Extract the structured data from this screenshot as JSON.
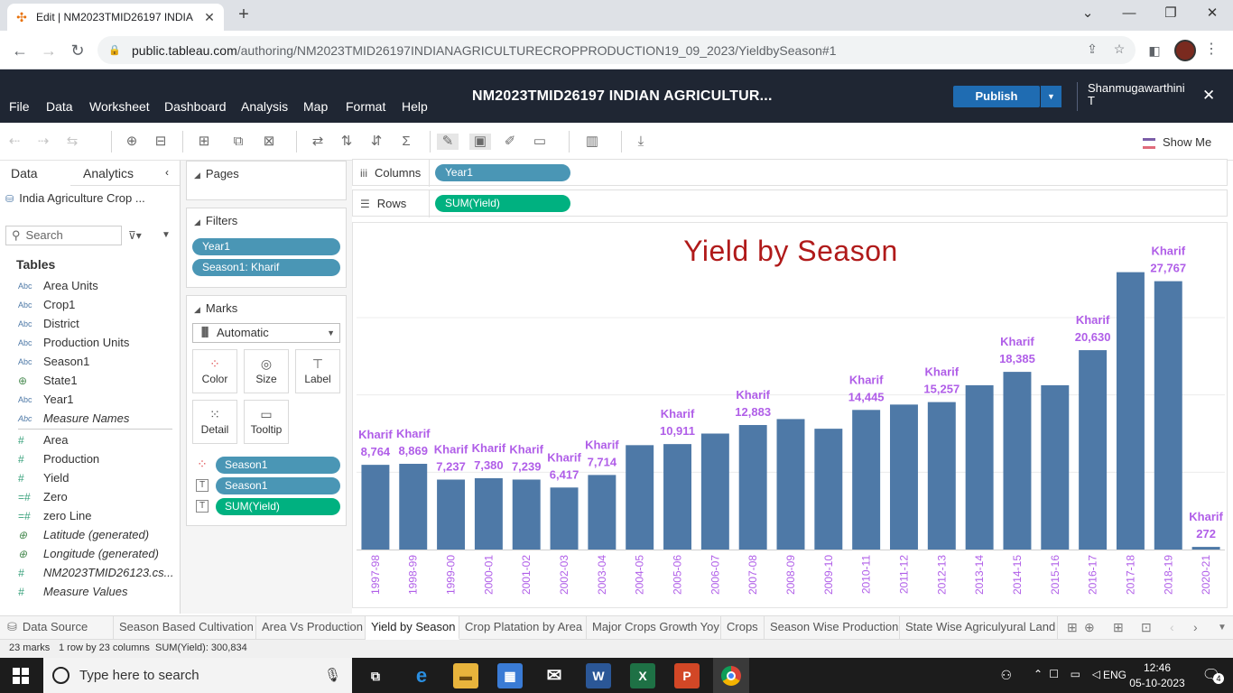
{
  "browser": {
    "tab_title": "Edit | NM2023TMID26197 INDIA",
    "url_host": "public.tableau.com",
    "url_path": "/authoring/NM2023TMID26197INDIANAGRICULTURECROPPRODUCTION19_09_2023/YieldbySeason#1"
  },
  "menu": {
    "items": [
      "File",
      "Data",
      "Worksheet",
      "Dashboard",
      "Analysis",
      "Map",
      "Format",
      "Help"
    ],
    "workbook_title": "NM2023TMID26197 INDIAN AGRICULTUR...",
    "publish_label": "Publish",
    "user_name": "Shanmugawarthini T"
  },
  "toolbar": {
    "show_me": "Show Me"
  },
  "data_pane": {
    "tab_data": "Data",
    "tab_analytics": "Analytics",
    "data_source": "India Agriculture Crop ...",
    "search_placeholder": "Search",
    "tables_heading": "Tables",
    "dimensions": [
      {
        "type": "Abc",
        "name": "Area Units",
        "italic": false
      },
      {
        "type": "Abc",
        "name": "Crop1",
        "italic": false
      },
      {
        "type": "Abc",
        "name": "District",
        "italic": false
      },
      {
        "type": "Abc",
        "name": "Production Units",
        "italic": false
      },
      {
        "type": "Abc",
        "name": "Season1",
        "italic": false
      },
      {
        "type": "globe",
        "name": "State1",
        "italic": false
      },
      {
        "type": "Abc",
        "name": "Year1",
        "italic": false
      },
      {
        "type": "Abc",
        "name": "Measure Names",
        "italic": true
      }
    ],
    "measures": [
      {
        "type": "#",
        "name": "Area",
        "italic": false
      },
      {
        "type": "#",
        "name": "Production",
        "italic": false
      },
      {
        "type": "#",
        "name": "Yield",
        "italic": false
      },
      {
        "type": "=#",
        "name": "Zero",
        "italic": false
      },
      {
        "type": "=#",
        "name": "zero Line",
        "italic": false
      },
      {
        "type": "globe",
        "name": "Latitude (generated)",
        "italic": true
      },
      {
        "type": "globe",
        "name": "Longitude (generated)",
        "italic": true
      },
      {
        "type": "#",
        "name": "NM2023TMID26123.cs...",
        "italic": true
      },
      {
        "type": "#",
        "name": "Measure Values",
        "italic": true
      }
    ]
  },
  "cards": {
    "pages_label": "Pages",
    "filters_label": "Filters",
    "filters": [
      "Year1",
      "Season1: Kharif"
    ],
    "marks_label": "Marks",
    "mark_type": "Automatic",
    "mark_buttons": [
      "Color",
      "Size",
      "Label",
      "Detail",
      "Tooltip"
    ],
    "mark_pills": [
      {
        "icon": "color-dots-icon",
        "label": "Season1",
        "kind": "dimension"
      },
      {
        "icon": "text-icon",
        "label": "Season1",
        "kind": "dimension"
      },
      {
        "icon": "text-icon",
        "label": "SUM(Yield)",
        "kind": "measure"
      }
    ]
  },
  "shelves": {
    "columns_label": "Columns",
    "columns_pill": "Year1",
    "rows_label": "Rows",
    "rows_pill": "SUM(Yield)"
  },
  "colors": {
    "bar": "#4e79a7",
    "label": "#b05ee8",
    "title": "#b01a1a",
    "dimension_pill": "#4a96b5",
    "measure_pill": "#00b180"
  },
  "chart_data": {
    "type": "bar",
    "title": "Yield by Season",
    "xlabel": "",
    "ylabel": "",
    "categories": [
      "1997-98",
      "1998-99",
      "1999-00",
      "2000-01",
      "2001-02",
      "2002-03",
      "2003-04",
      "2004-05",
      "2005-06",
      "2006-07",
      "2007-08",
      "2008-09",
      "2009-10",
      "2010-11",
      "2011-12",
      "2012-13",
      "2013-14",
      "2014-15",
      "2015-16",
      "2016-17",
      "2017-18",
      "2018-19",
      "2020-21"
    ],
    "series": [
      {
        "name": "Kharif",
        "values": [
          8764,
          8869,
          7237,
          7380,
          7239,
          6417,
          7714,
          10800,
          10911,
          12000,
          12883,
          13500,
          12500,
          14445,
          15000,
          15257,
          17000,
          18385,
          17000,
          20630,
          28700,
          27767,
          272
        ]
      }
    ],
    "data_labels": [
      "Kharif\n8,764",
      "Kharif\n8,869",
      "Kharif\n7,237",
      "Kharif\n7,380",
      "Kharif\n7,239",
      "Kharif\n6,417",
      "Kharif\n7,714",
      "",
      "Kharif\n10,911",
      "",
      "Kharif\n12,883",
      "",
      "",
      "Kharif\n14,445",
      "",
      "Kharif\n15,257",
      "",
      "Kharif\n18,385",
      "",
      "Kharif\n20,630",
      "",
      "Kharif\n27,767",
      "Kharif\n272"
    ],
    "ylim": [
      0,
      31000
    ],
    "grid": true
  },
  "sheet_tabs": {
    "data_source": "Data Source",
    "sheets": [
      "Season Based Cultivation",
      "Area Vs Production",
      "Yield by Season",
      "Crop Platation by Area",
      "Major Crops Growth Yoy",
      "Crops",
      "Season Wise Production",
      "State Wise Agriculyural Land"
    ],
    "active": "Yield by Season"
  },
  "status": {
    "marks": "23 marks",
    "dims": "1 row by 23 columns",
    "sum": "SUM(Yield): 300,834"
  },
  "taskbar": {
    "search_placeholder": "Type here to search",
    "lang": "ENG",
    "time": "12:46",
    "date": "05-10-2023",
    "notif_count": "4"
  }
}
